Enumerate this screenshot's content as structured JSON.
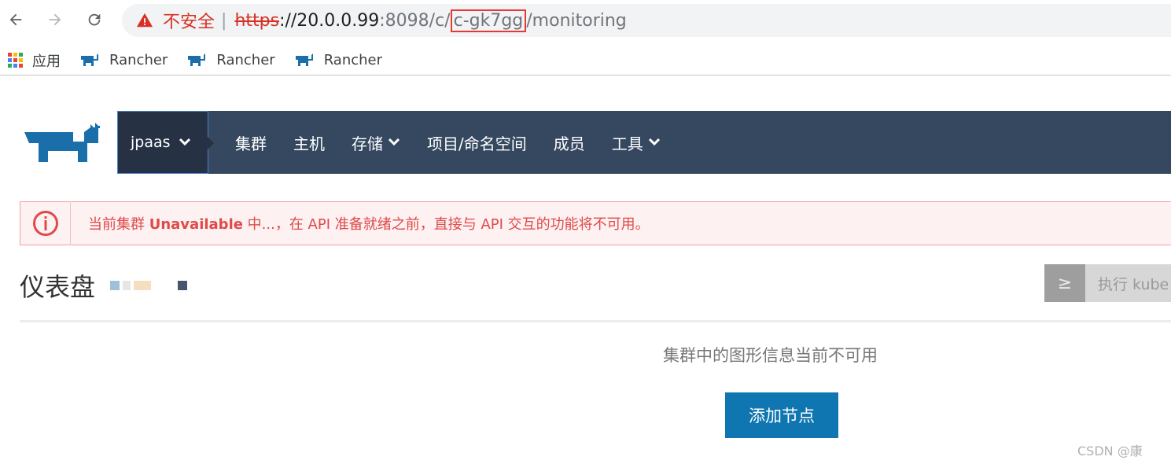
{
  "browser": {
    "url": {
      "insecure_label": "不安全",
      "separator": "|",
      "scheme": "https",
      "host_prefix": "://20.0.0.99",
      "port_path": ":8098/c/",
      "highlighted": "c-gk7gg",
      "suffix": "/monitoring"
    },
    "bookmarks": [
      {
        "label": "应用",
        "icon": "apps-grid-icon"
      },
      {
        "label": "Rancher",
        "icon": "rancher-icon"
      },
      {
        "label": "Rancher",
        "icon": "rancher-icon"
      },
      {
        "label": "Rancher",
        "icon": "rancher-icon"
      }
    ]
  },
  "topnav": {
    "cluster": "jpaas",
    "items": [
      {
        "label": "集群",
        "dropdown": false
      },
      {
        "label": "主机",
        "dropdown": false
      },
      {
        "label": "存储",
        "dropdown": true
      },
      {
        "label": "项目/命名空间",
        "dropdown": false
      },
      {
        "label": "成员",
        "dropdown": false
      },
      {
        "label": "工具",
        "dropdown": true
      }
    ]
  },
  "alert": {
    "prefix": "当前集群 ",
    "status": "Unavailable",
    "suffix": " 中...，在 API 准备就绪之前，直接与 API 交互的功能将不可用。"
  },
  "page": {
    "title": "仪表盘",
    "kubectl_button": "执行 kube",
    "empty_message": "集群中的图形信息当前不可用",
    "add_node_button": "添加节点",
    "watermark": "CSDN @康"
  },
  "colors": {
    "nav_bg": "#354860",
    "cluster_bg": "#263244",
    "alert_text": "#e04a4a",
    "primary": "#0f76b1",
    "logo": "#1a6faa"
  }
}
